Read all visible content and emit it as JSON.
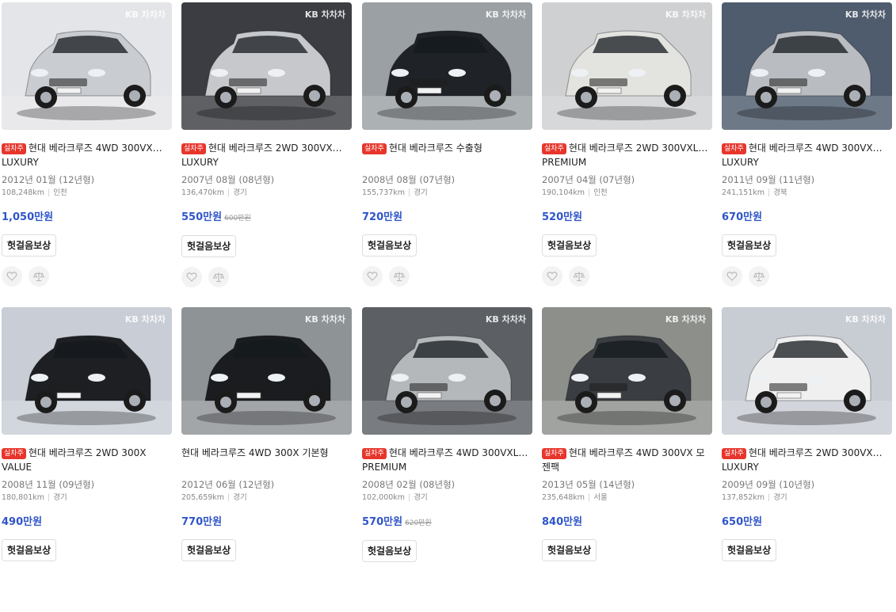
{
  "badge_label": "실차주",
  "compensation_label": "헛걸음보상",
  "watermark": "KB 차차차",
  "listings": [
    {
      "title": "현대 베라크루즈 4WD 300VX… LUXURY",
      "badge": true,
      "year": "2012년 01월 (12년형)",
      "km": "108,248km",
      "region": "인천",
      "price": "1,050만원",
      "orig_price": "",
      "car_color": "#c9ccd1",
      "bg": "#e4e5e8"
    },
    {
      "title": "현대 베라크루즈 2WD 300VX… LUXURY",
      "badge": true,
      "year": "2007년 08월 (08년형)",
      "km": "136,470km",
      "region": "경기",
      "price": "550만원",
      "orig_price": "600만원",
      "car_color": "#c6c8cc",
      "bg": "#3b3d42"
    },
    {
      "title": "현대 베라크루즈 수출형",
      "badge": true,
      "year": "2008년 08월 (07년형)",
      "km": "155,737km",
      "region": "경기",
      "price": "720만원",
      "orig_price": "",
      "car_color": "#1f2226",
      "bg": "#9aa0a3"
    },
    {
      "title": "현대 베라크루즈 2WD 300VXL… PREMIUM",
      "badge": true,
      "year": "2007년 04월 (07년형)",
      "km": "190,104km",
      "region": "인천",
      "price": "520만원",
      "orig_price": "",
      "car_color": "#e3e3e0",
      "bg": "#cfd0d2"
    },
    {
      "title": "현대 베라크루즈 4WD 300VX… LUXURY",
      "badge": true,
      "year": "2011년 09월 (11년형)",
      "km": "241,151km",
      "region": "경북",
      "price": "670만원",
      "orig_price": "",
      "car_color": "#b9bcc0",
      "bg": "#4f5c6e"
    },
    {
      "title": "현대 베라크루즈 2WD 300X VALUE",
      "badge": true,
      "year": "2008년 11월 (09년형)",
      "km": "180,801km",
      "region": "경기",
      "price": "490만원",
      "orig_price": "",
      "car_color": "#1d1f23",
      "bg": "#c9cdd6"
    },
    {
      "title": "현대 베라크루즈 4WD 300X 기본형",
      "badge": false,
      "year": "2012년 06월 (12년형)",
      "km": "205,659km",
      "region": "경기",
      "price": "770만원",
      "orig_price": "",
      "car_color": "#1a1c1f",
      "bg": "#8e9396"
    },
    {
      "title": "현대 베라크루즈 4WD 300VXL… PREMIUM",
      "badge": true,
      "year": "2008년 02월 (08년형)",
      "km": "102,000km",
      "region": "경기",
      "price": "570만원",
      "orig_price": "620만원",
      "car_color": "#b5b8bb",
      "bg": "#5c6064"
    },
    {
      "title": "현대 베라크루즈 4WD 300VX 모젠팩",
      "badge": true,
      "year": "2013년 05월 (14년형)",
      "km": "235,648km",
      "region": "서울",
      "price": "840만원",
      "orig_price": "",
      "car_color": "#3a3d42",
      "bg": "#8c8f8a"
    },
    {
      "title": "현대 베라크루즈 2WD 300VX… LUXURY",
      "badge": true,
      "year": "2009년 09월 (10년형)",
      "km": "137,852km",
      "region": "경기",
      "price": "650만원",
      "orig_price": "",
      "car_color": "#f0f0f0",
      "bg": "#c8ccd3"
    }
  ]
}
